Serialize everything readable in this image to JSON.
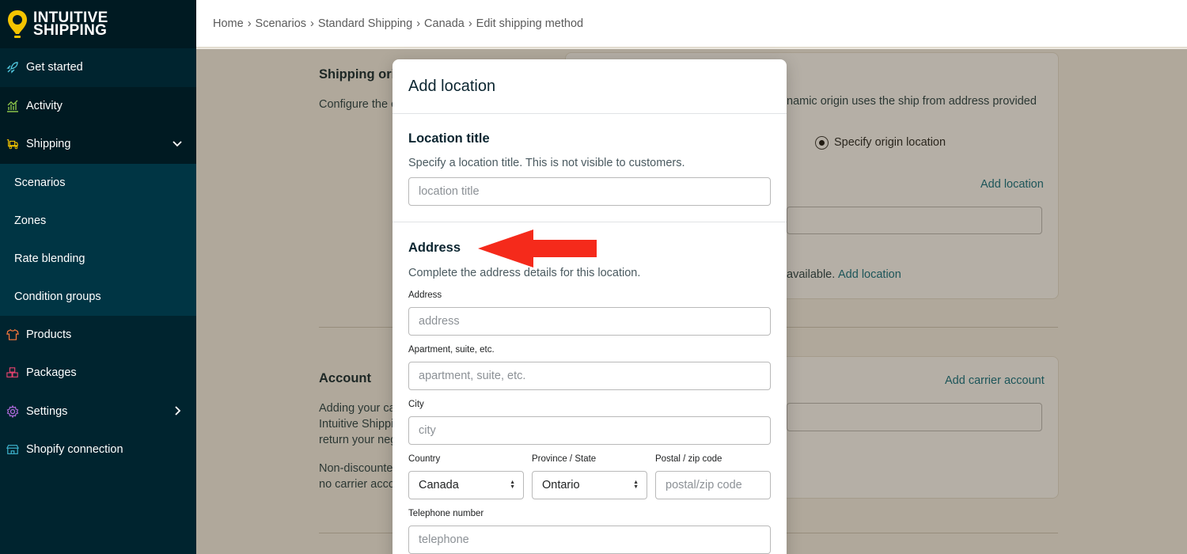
{
  "brand": {
    "line1": "INTUITIVE",
    "line2": "SHIPPING",
    "accent": "#f5c400"
  },
  "sidebar": {
    "items": [
      {
        "label": "Get started",
        "icon": "rocket-icon"
      },
      {
        "label": "Activity",
        "icon": "activity-chart-icon"
      },
      {
        "label": "Shipping",
        "icon": "truck-icon"
      },
      {
        "label": "Products",
        "icon": "shirt-icon"
      },
      {
        "label": "Packages",
        "icon": "packages-icon"
      },
      {
        "label": "Settings",
        "icon": "gear-icon"
      },
      {
        "label": "Shopify connection",
        "icon": "store-icon"
      }
    ],
    "shipping_sub": [
      "Scenarios",
      "Zones",
      "Rate blending",
      "Condition groups"
    ]
  },
  "breadcrumb": [
    "Home",
    "Scenarios",
    "Standard Shipping",
    "Canada",
    "Edit shipping method"
  ],
  "background": {
    "origin_title": "Shipping origi",
    "origin_desc": "Configure the o",
    "dynamic_text": "namic origin uses the ship from address provided",
    "radio_label": "Specify origin location",
    "add_location": "Add location",
    "available_text": "available.",
    "add_location_2": "Add location",
    "account_title": "Account",
    "account_desc_1": "Adding your ca",
    "account_desc_2": "Intuitive Shippi",
    "account_desc_3": "return your neg",
    "account_desc_4": "Non-discounted",
    "account_desc_5": "no carrier acco",
    "add_carrier": "Add carrier account"
  },
  "modal": {
    "title": "Add location",
    "location_title": {
      "heading": "Location title",
      "desc": "Specify a location title. This is not visible to customers.",
      "placeholder": "location title"
    },
    "address": {
      "heading": "Address",
      "desc": "Complete the address details for this location.",
      "address_label": "Address",
      "address_placeholder": "address",
      "apt_label": "Apartment, suite, etc.",
      "apt_placeholder": "apartment, suite, etc.",
      "city_label": "City",
      "city_placeholder": "city",
      "country_label": "Country",
      "country_value": "Canada",
      "province_label": "Province / State",
      "province_value": "Ontario",
      "postal_label": "Postal / zip code",
      "postal_placeholder": "postal/zip code",
      "phone_label": "Telephone number",
      "phone_placeholder": "telephone"
    }
  },
  "colors": {
    "sidebar": "#00242f",
    "link": "#0a6f84",
    "annotation_arrow": "#f52a1b"
  }
}
